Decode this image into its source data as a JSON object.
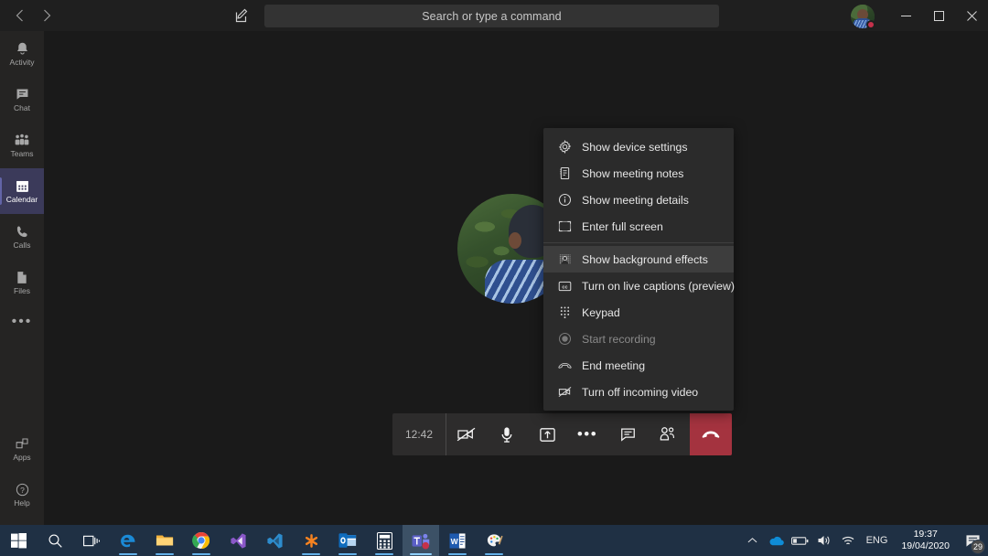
{
  "titlebar": {
    "back_icon": "chevron-left-icon",
    "forward_icon": "chevron-right-icon",
    "compose_icon": "compose-pencil-icon",
    "search": {
      "placeholder": "Search or type a command",
      "value": ""
    },
    "avatar_name": "user-avatar",
    "presence": "busy",
    "presence_color": "#c4314b",
    "minimize_label": "—",
    "maximize_label": "❐",
    "close_label": "✕"
  },
  "sidebar": {
    "items": [
      {
        "label": "Activity",
        "icon": "bell-icon",
        "active": false
      },
      {
        "label": "Chat",
        "icon": "chat-icon",
        "active": false
      },
      {
        "label": "Teams",
        "icon": "teams-people-icon",
        "active": false
      },
      {
        "label": "Calendar",
        "icon": "calendar-icon",
        "active": true
      },
      {
        "label": "Calls",
        "icon": "phone-icon",
        "active": false
      },
      {
        "label": "Files",
        "icon": "files-icon",
        "active": false
      }
    ],
    "more_label": "•••",
    "bottom_items": [
      {
        "label": "Apps",
        "icon": "apps-icon"
      },
      {
        "label": "Help",
        "icon": "help-circle-icon"
      }
    ],
    "active_color": "#3b3a5a",
    "accent_color": "#6264a7"
  },
  "meeting": {
    "timer": "12:42",
    "controls": [
      {
        "name": "camera-off-button",
        "icon": "video-off-icon"
      },
      {
        "name": "microphone-button",
        "icon": "microphone-icon"
      },
      {
        "name": "share-screen-button",
        "icon": "share-screen-icon"
      },
      {
        "name": "more-actions-button",
        "icon": "ellipsis-icon",
        "label": "•••"
      },
      {
        "name": "show-conversation-button",
        "icon": "chat-bubble-icon"
      },
      {
        "name": "show-participants-button",
        "icon": "participants-icon"
      }
    ],
    "hangup": {
      "name": "hang-up-button",
      "icon": "hangup-phone-icon",
      "color": "#a4333f"
    }
  },
  "context_menu": {
    "highlight_color": "#3d3d3d",
    "background_color": "#2b2b2b",
    "items": [
      {
        "label": "Show device settings",
        "icon": "gear-icon",
        "disabled": false,
        "highlighted": false,
        "separator_above": false
      },
      {
        "label": "Show meeting notes",
        "icon": "notes-icon",
        "disabled": false,
        "highlighted": false,
        "separator_above": false
      },
      {
        "label": "Show meeting details",
        "icon": "info-circle-icon",
        "disabled": false,
        "highlighted": false,
        "separator_above": false
      },
      {
        "label": "Enter full screen",
        "icon": "full-screen-icon",
        "disabled": false,
        "highlighted": false,
        "separator_above": false
      },
      {
        "label": "Show background effects",
        "icon": "background-effects-icon",
        "disabled": false,
        "highlighted": true,
        "separator_above": true
      },
      {
        "label": "Turn on live captions (preview)",
        "icon": "closed-captions-icon",
        "disabled": false,
        "highlighted": false,
        "separator_above": false
      },
      {
        "label": "Keypad",
        "icon": "keypad-icon",
        "disabled": false,
        "highlighted": false,
        "separator_above": false
      },
      {
        "label": "Start recording",
        "icon": "record-icon",
        "disabled": true,
        "highlighted": false,
        "separator_above": false
      },
      {
        "label": "End meeting",
        "icon": "hangup-phone-icon",
        "disabled": false,
        "highlighted": false,
        "separator_above": false
      },
      {
        "label": "Turn off incoming video",
        "icon": "video-off-icon",
        "disabled": false,
        "highlighted": false,
        "separator_above": false
      }
    ]
  },
  "taskbar": {
    "items": [
      {
        "name": "start-button",
        "icon": "windows-logo-icon",
        "running": false,
        "active": false
      },
      {
        "name": "taskbar-search",
        "icon": "search-icon",
        "running": false,
        "active": false
      },
      {
        "name": "task-view-button",
        "icon": "task-view-icon",
        "running": false,
        "active": false
      },
      {
        "name": "taskbar-edge",
        "icon": "edge-icon",
        "running": true,
        "active": false
      },
      {
        "name": "taskbar-file-explorer",
        "icon": "file-explorer-icon",
        "running": true,
        "active": false
      },
      {
        "name": "taskbar-chrome",
        "icon": "chrome-icon",
        "running": true,
        "active": false
      },
      {
        "name": "taskbar-visual-studio",
        "icon": "visual-studio-icon",
        "running": false,
        "active": false
      },
      {
        "name": "taskbar-vs-code",
        "icon": "vs-code-icon",
        "running": false,
        "active": false
      },
      {
        "name": "taskbar-gotomeeting",
        "icon": "asterisk-icon",
        "running": true,
        "active": false
      },
      {
        "name": "taskbar-outlook",
        "icon": "outlook-icon",
        "running": true,
        "active": false
      },
      {
        "name": "taskbar-calculator",
        "icon": "calculator-icon",
        "running": true,
        "active": false
      },
      {
        "name": "taskbar-teams",
        "icon": "teams-icon",
        "running": true,
        "active": true
      },
      {
        "name": "taskbar-word",
        "icon": "word-icon",
        "running": true,
        "active": false
      },
      {
        "name": "taskbar-paint",
        "icon": "paint-icon",
        "running": true,
        "active": false
      }
    ],
    "tray": {
      "overflow_icon": "chevron-up-icon",
      "onedrive_icon": "onedrive-cloud-icon",
      "battery_icon": "battery-icon",
      "volume_icon": "volume-icon",
      "network_icon": "wifi-icon",
      "language": "ENG",
      "time": "19:37",
      "date": "19/04/2020",
      "notifications_icon": "notifications-icon",
      "notification_count": "29"
    }
  }
}
